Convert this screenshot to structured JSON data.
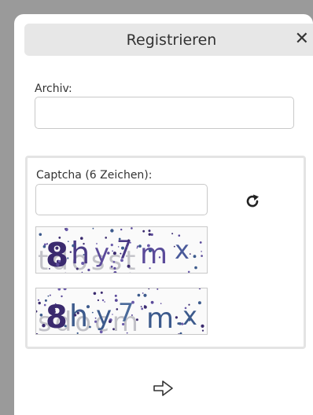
{
  "dialog": {
    "title": "Registrieren",
    "close_symbol": "✕"
  },
  "archiv": {
    "label": "Archiv:",
    "value": "",
    "placeholder": ""
  },
  "captcha": {
    "label": "Captcha (6 Zeichen):",
    "value": "",
    "placeholder": "",
    "refresh_icon": "refresh-icon",
    "image_1_text": "8hy7mx",
    "image_1_noise": "tdosst",
    "image_2_text": "8hy7mx",
    "image_2_noise": "sdocm"
  },
  "submit": {
    "icon": "arrow-right-icon"
  },
  "colors": {
    "captcha_dark": "#3a2a6e",
    "captcha_mid": "#5b4a9a",
    "captcha_blue": "#3c5a8c",
    "captcha_noise": "#a9a9b0"
  }
}
